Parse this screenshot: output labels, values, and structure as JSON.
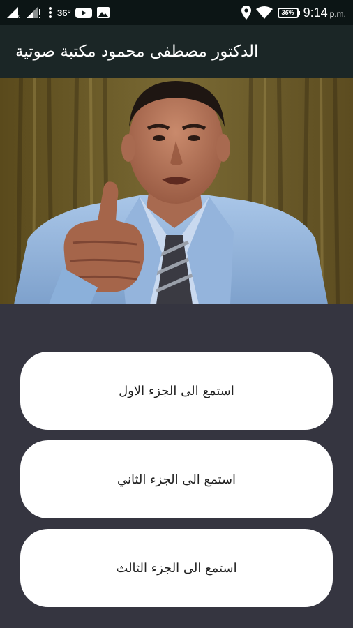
{
  "status_bar": {
    "temperature": "36°",
    "battery_percent": "36%",
    "time": "9:14",
    "ampm": "p.m."
  },
  "app_bar": {
    "title": "الدكتور مصطفى محمود مكتبة صوتية"
  },
  "buttons": [
    {
      "label": "استمع الى الجزء الاول"
    },
    {
      "label": "استمع الى الجزء الثاني"
    },
    {
      "label": "استمع الى الجزء الثالث"
    }
  ]
}
